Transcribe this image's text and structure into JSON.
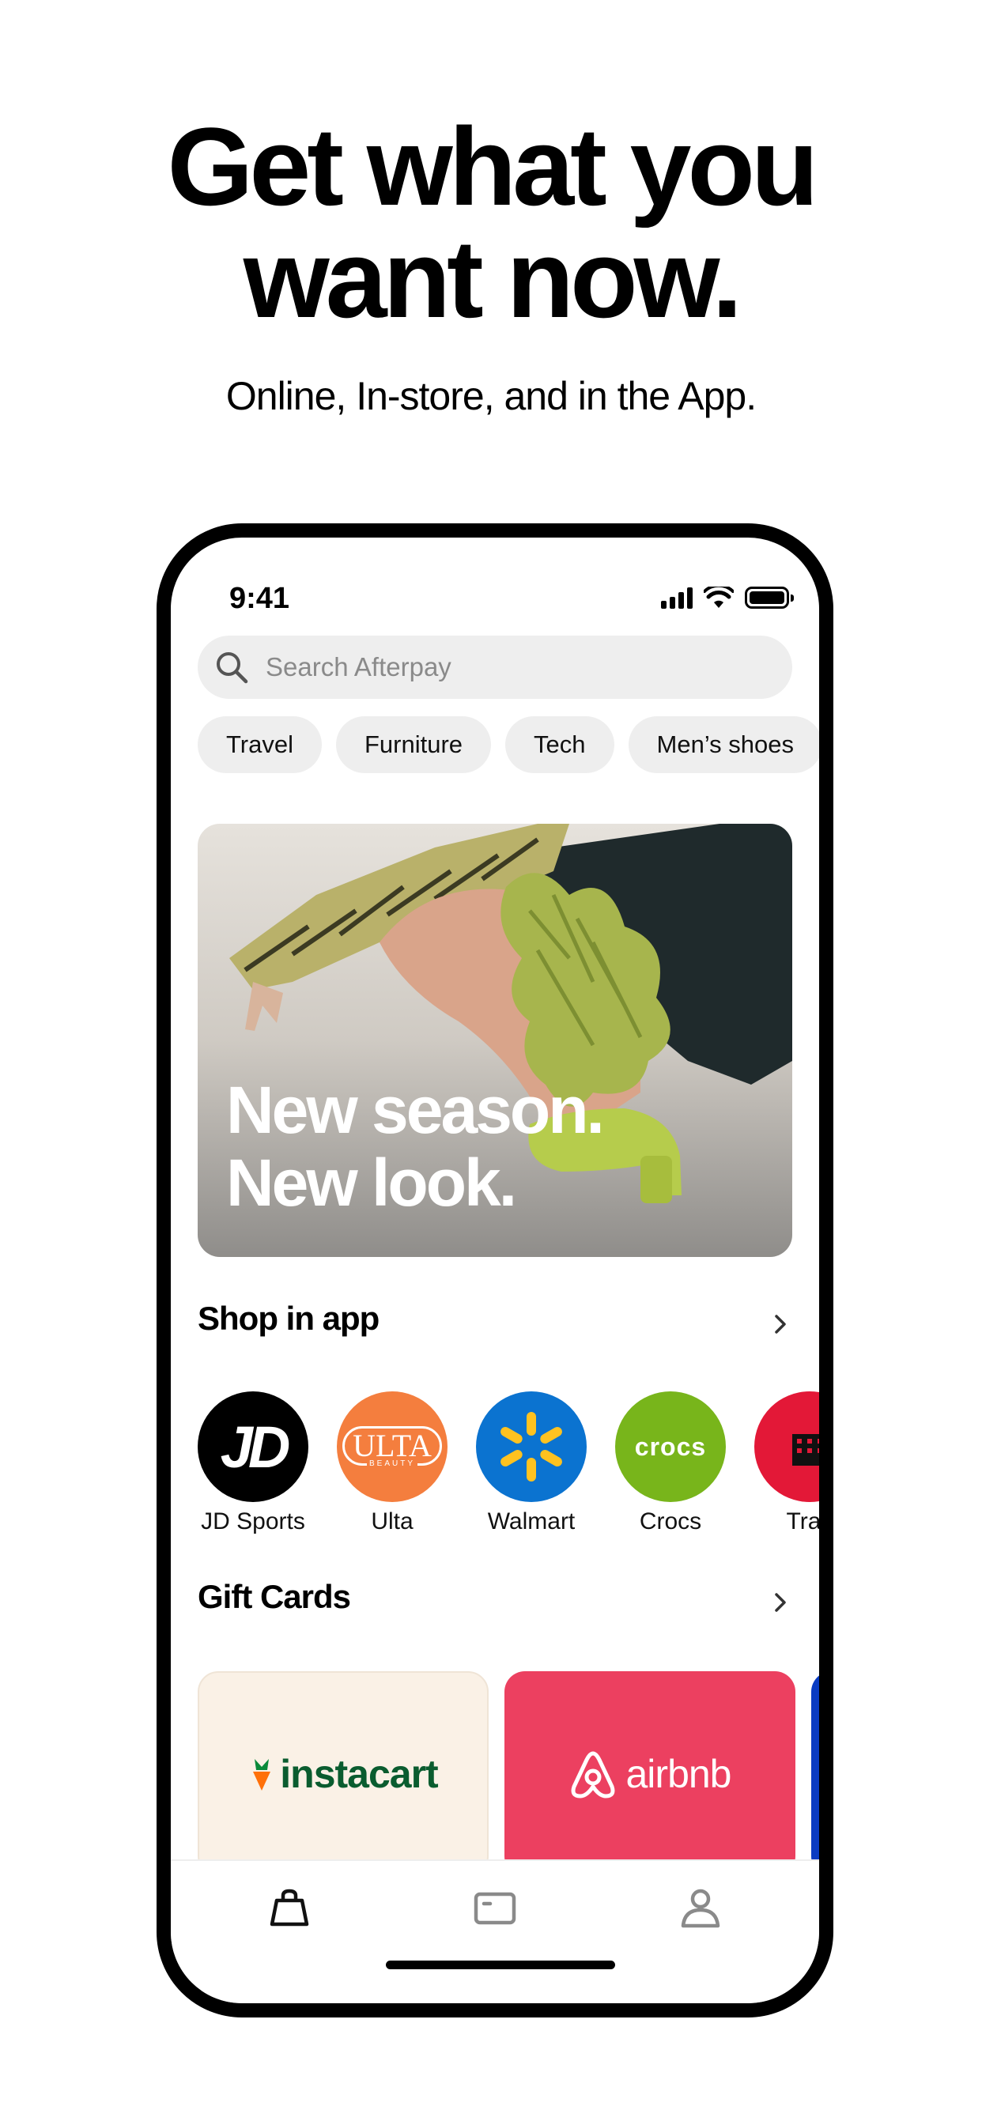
{
  "marketing": {
    "headline_line1": "Get what you",
    "headline_line2": "want now.",
    "subhead": "Online, In-store, and in the App."
  },
  "status_bar": {
    "time": "9:41"
  },
  "search": {
    "placeholder": "Search Afterpay",
    "icon": "search-icon"
  },
  "chips": [
    {
      "label": "Travel"
    },
    {
      "label": "Furniture"
    },
    {
      "label": "Tech"
    },
    {
      "label": "Men’s shoes"
    }
  ],
  "hero": {
    "line1": "New season.",
    "line2": "New look."
  },
  "shop_in_app": {
    "title": "Shop in app",
    "brands": [
      {
        "name": "JD Sports",
        "logo_text": "JD",
        "bg": "#000000"
      },
      {
        "name": "Ulta",
        "logo_text": "ULTA",
        "logo_subtext": "BEAUTY",
        "bg": "#f47e3e"
      },
      {
        "name": "Walmart",
        "bg": "#0b73d0",
        "accent": "#ffc220"
      },
      {
        "name": "Crocs",
        "logo_text": "crocs",
        "bg": "#78b51b"
      },
      {
        "name": "Trav",
        "bg": "#e31837"
      }
    ]
  },
  "gift_cards": {
    "title": "Gift Cards",
    "cards": [
      {
        "label": "instacart",
        "bg": "#faf1e6",
        "fg": "#0a5c2f",
        "accent": "#ff7009"
      },
      {
        "label": "airbnb",
        "bg": "#ec4060",
        "fg": "#ffffff"
      }
    ]
  },
  "tabbar": {
    "tabs": [
      "shop-icon",
      "card-icon",
      "account-icon"
    ]
  }
}
